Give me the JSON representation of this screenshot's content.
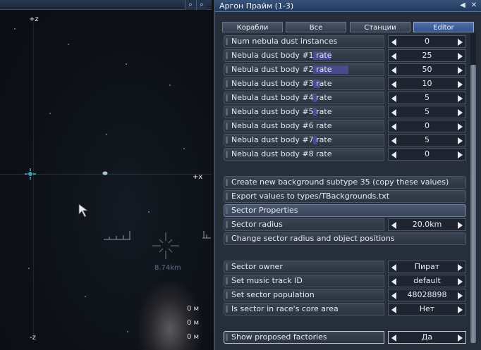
{
  "map": {
    "axis_top": "+z",
    "axis_bottom": "-z",
    "axis_right": "+x",
    "distance_label": "8.74km",
    "range_values": [
      "0 м",
      "0 м",
      "0 м"
    ]
  },
  "panel": {
    "title": "Аргон Прайм (1-3)",
    "tabs": [
      {
        "label": "Корабли",
        "active": false
      },
      {
        "label": "Все",
        "active": false
      },
      {
        "label": "Станции",
        "active": false
      },
      {
        "label": "Editor",
        "active": true
      }
    ],
    "rows": [
      {
        "label": "Num nebula dust instances",
        "value": "0",
        "fill": 0
      },
      {
        "label": "Nebula dust body #1 rate",
        "value": "25",
        "fill": 0.25
      },
      {
        "label": "Nebula dust body #2 rate",
        "value": "50",
        "fill": 0.5
      },
      {
        "label": "Nebula dust body #3 rate",
        "value": "10",
        "fill": 0.1
      },
      {
        "label": "Nebula dust body #4 rate",
        "value": "5",
        "fill": 0.05
      },
      {
        "label": "Nebula dust body #5 rate",
        "value": "5",
        "fill": 0.05
      },
      {
        "label": "Nebula dust body #6 rate",
        "value": "0",
        "fill": 0
      },
      {
        "label": "Nebula dust body #7 rate",
        "value": "5",
        "fill": 0.05
      },
      {
        "label": "Nebula dust body #8 rate",
        "value": "0",
        "fill": 0
      }
    ],
    "actions": {
      "create_bg": "Create new background subtype 35 (copy these values)",
      "export_values": "Export values to types/TBackgrounds.txt",
      "sector_properties": "Sector Properties",
      "change_radius": "Change sector radius and object positions"
    },
    "sector_radius": {
      "label": "Sector radius",
      "value": "20.0km (100%)"
    },
    "sector_rows": [
      {
        "label": "Sector owner",
        "value": "Пират"
      },
      {
        "label": "Set music track ID",
        "value": "default"
      },
      {
        "label": "Set sector population",
        "value": "48028898"
      },
      {
        "label": "Is sector in race's core area",
        "value": "Нет"
      }
    ],
    "factories": {
      "label": "Show proposed factories",
      "value": "Да"
    }
  }
}
